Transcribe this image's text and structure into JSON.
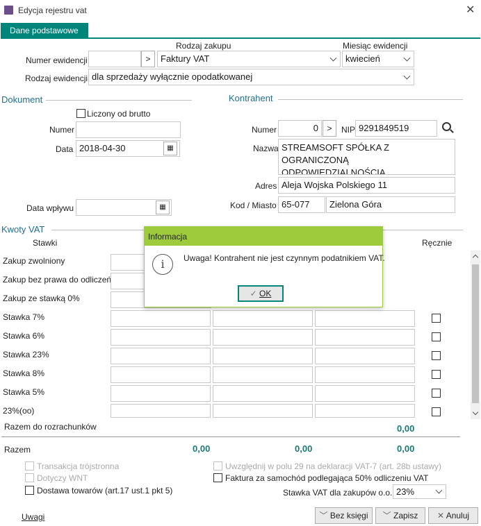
{
  "window": {
    "title": "Edycja rejestru vat"
  },
  "tabs": [
    {
      "label": "Dane podstawowe"
    }
  ],
  "top": {
    "numer_ewidencji_label": "Numer ewidencji",
    "numer_ewidencji_value": "",
    "rodzaj_zakupu_label": "Rodzaj zakupu",
    "rodzaj_zakupu_value": "Faktury VAT",
    "miesiac_label": "Miesiąc ewidencji",
    "miesiac_value": "kwiecień",
    "rodzaj_ewidencji_label": "Rodzaj ewidencji",
    "rodzaj_ewidencji_value": "dla sprzedaży wyłącznie opodatkowanej"
  },
  "dokument": {
    "section": "Dokument",
    "liczony_label": "Liczony od brutto",
    "numer_label": "Numer",
    "numer_value": "",
    "data_label": "Data",
    "data_value": "2018-04-30",
    "data_wplywu_label": "Data wpływu",
    "data_wplywu_value": ""
  },
  "kontrahent": {
    "section": "Kontrahent",
    "numer_label": "Numer",
    "numer_value": "0",
    "nip_label": "NIP",
    "nip_value": "9291849519",
    "nazwa_label": "Nazwa",
    "nazwa_line1": "STREAMSOFT  SPÓŁKA Z OGRANICZONĄ",
    "nazwa_line2": "ODPOWIEDZIALNOŚCIĄ",
    "adres_label": "Adres",
    "adres_value": "Aleja Wojska Polskiego 11",
    "kod_label": "Kod / Miasto",
    "kod_value": "65-077",
    "miasto_value": "Zielona Góra"
  },
  "kwoty": {
    "section": "Kwoty VAT",
    "stawki_header": "Stawki",
    "recznie_header": "Ręcznie",
    "rows": [
      {
        "label": "Zakup zwolniony"
      },
      {
        "label": "Zakup bez prawa do odliczeń"
      },
      {
        "label": "Zakup ze stawką 0%"
      },
      {
        "label": "Stawka 7%"
      },
      {
        "label": "Stawka 6%"
      },
      {
        "label": "Stawka 23%"
      },
      {
        "label": "Stawka 8%"
      },
      {
        "label": "Stawka 5%"
      },
      {
        "label": "23%(oo)"
      }
    ],
    "razem_rozrachunkow_label": "Razem do rozrachunków",
    "razem_rozrachunkow_value": "0,00",
    "razem_label": "Razem",
    "razem_values": [
      "0,00",
      "0,00",
      "0,00"
    ]
  },
  "options": {
    "transakcja": "Transakcja trójstronna",
    "wnt": "Dotyczy WNT",
    "dostawa": "Dostawa towarów (art.17 ust.1 pkt 5)",
    "uwzglednij": "Uwzględnij w polu 29 na deklaracji VAT-7 (art. 28b ustawy)",
    "faktura_samochod": "Faktura za samochód podlegająca 50% odliczeniu VAT",
    "stawka_oo_label": "Stawka VAT dla zakupów o.o.",
    "stawka_oo_value": "23%"
  },
  "footer": {
    "uwagi": "Uwagi",
    "bez_ksiegi": "Bez księgi",
    "zapisz": "Zapisz",
    "anuluj": "Anuluj"
  },
  "dialog": {
    "title": "Informacja",
    "message": "Uwaga! Kontrahent nie jest czynnym podatnikiem VAT.",
    "ok": "OK",
    "icon": "info-icon"
  },
  "colors": {
    "accent": "#00857a",
    "dialog_bar": "#9dcb3c",
    "section": "#1f6f94"
  }
}
